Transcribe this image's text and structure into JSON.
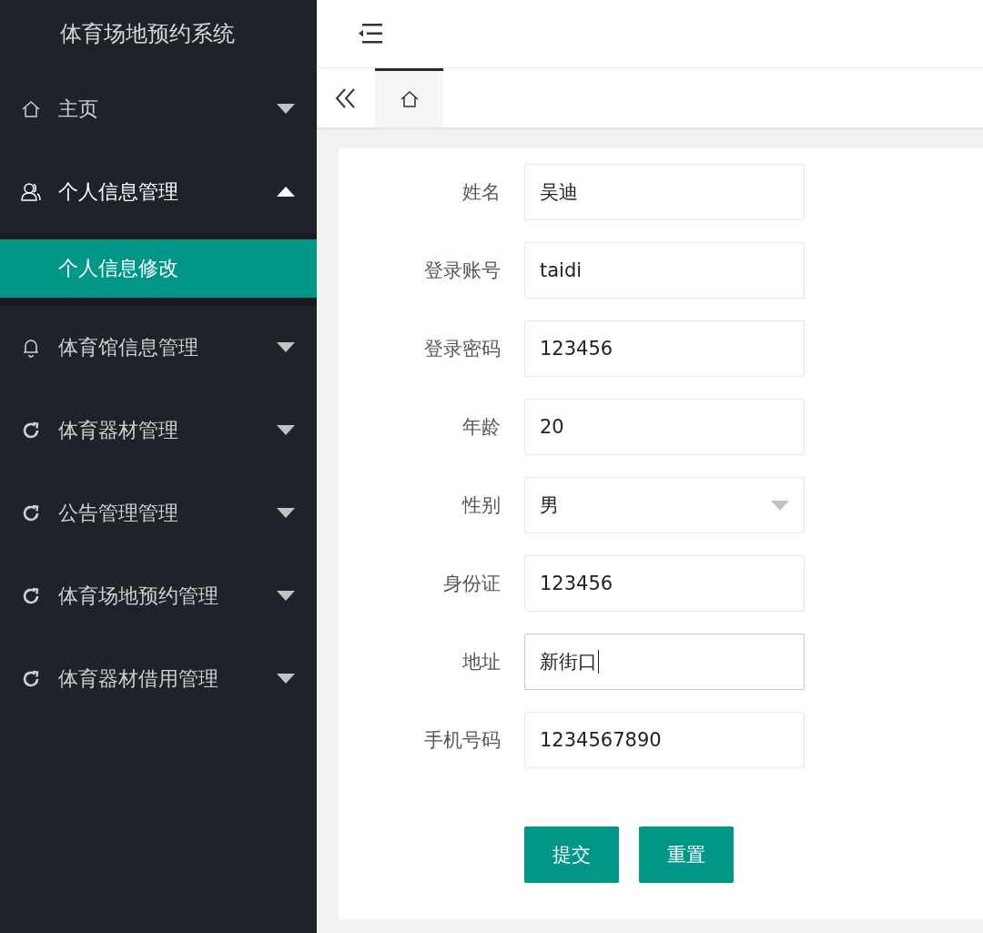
{
  "sidebar": {
    "title": "体育场地预约系统",
    "items": [
      {
        "label": "主页",
        "kind": "home",
        "expanded": false
      },
      {
        "label": "个人信息管理",
        "kind": "user",
        "expanded": true,
        "children": [
          {
            "label": "个人信息修改",
            "selected": true
          }
        ]
      },
      {
        "label": "体育馆信息管理",
        "kind": "bell",
        "expanded": false
      },
      {
        "label": "体育器材管理",
        "kind": "refresh",
        "expanded": false
      },
      {
        "label": "公告管理管理",
        "kind": "refresh",
        "expanded": false
      },
      {
        "label": "体育场地预约管理",
        "kind": "refresh",
        "expanded": false
      },
      {
        "label": "体育器材借用管理",
        "kind": "refresh",
        "expanded": false
      }
    ]
  },
  "tabs": [
    {
      "kind": "home",
      "selected": true
    }
  ],
  "form": {
    "fields": [
      {
        "label": "姓名",
        "value": "吴迪",
        "kind": "text",
        "focused": false
      },
      {
        "label": "登录账号",
        "value": "taidi",
        "kind": "text",
        "focused": false
      },
      {
        "label": "登录密码",
        "value": "123456",
        "kind": "text",
        "focused": false
      },
      {
        "label": "年龄",
        "value": "20",
        "kind": "text",
        "focused": false
      },
      {
        "label": "性别",
        "value": "男",
        "kind": "select",
        "focused": false
      },
      {
        "label": "身份证",
        "value": "123456",
        "kind": "text",
        "focused": false
      },
      {
        "label": "地址",
        "value": "新街口",
        "kind": "text",
        "focused": true
      },
      {
        "label": "手机号码",
        "value": "1234567890",
        "kind": "text",
        "focused": false
      }
    ],
    "buttons": [
      "提交",
      "重置"
    ]
  }
}
